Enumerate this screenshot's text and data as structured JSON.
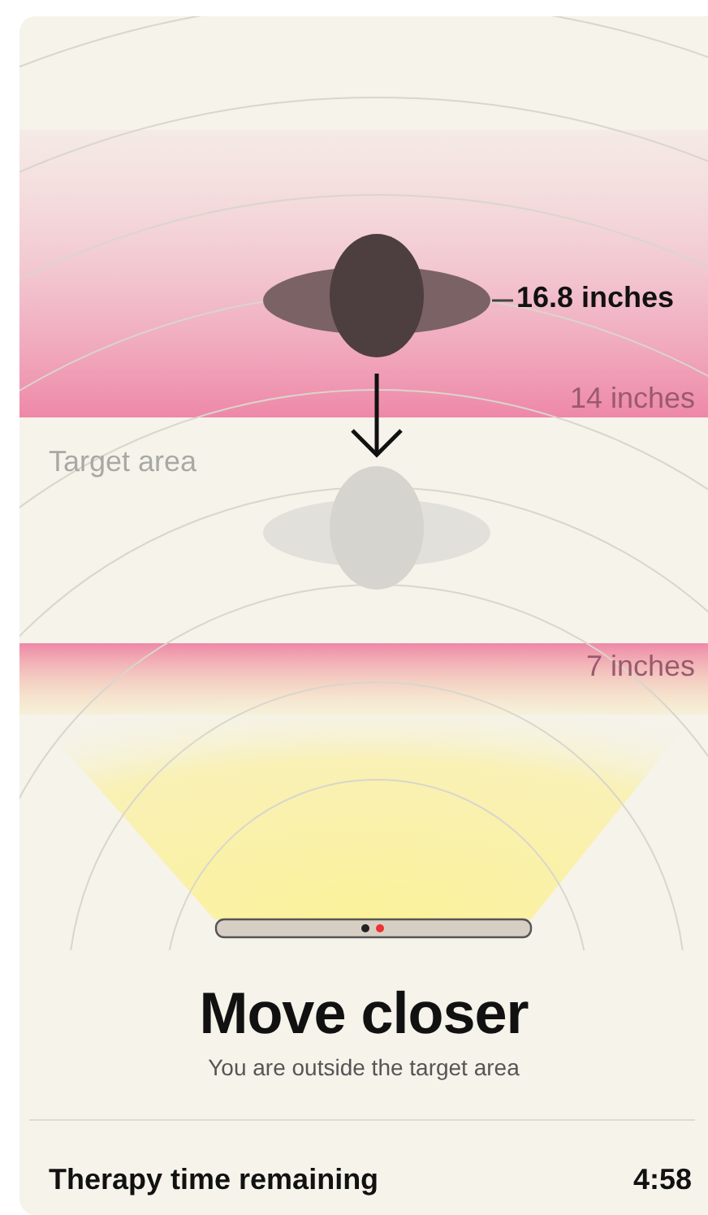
{
  "diagram": {
    "user_distance": "16.8 inches",
    "far_limit": "14 inches",
    "target_label": "Target area",
    "near_limit": "7 inches"
  },
  "status": {
    "title": "Move closer",
    "message": "You are outside the target area"
  },
  "timer": {
    "label": "Therapy time remaining",
    "value": "4:58"
  }
}
